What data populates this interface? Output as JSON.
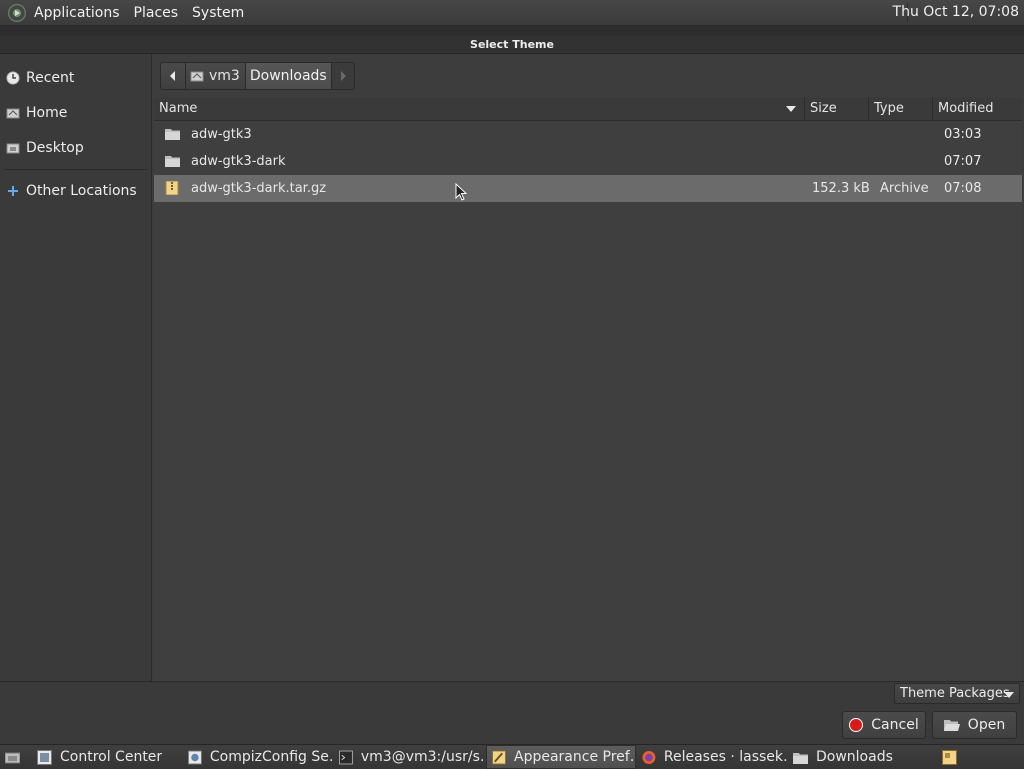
{
  "topbar": {
    "menus": [
      "Applications",
      "Places",
      "System"
    ],
    "clock": "Thu Oct 12, 07:08"
  },
  "dialog": {
    "title": "Select Theme"
  },
  "sidebar": {
    "items": [
      {
        "label": "Recent",
        "icon": "clock-icon"
      },
      {
        "label": "Home",
        "icon": "home-icon"
      },
      {
        "label": "Desktop",
        "icon": "desktop-icon"
      },
      {
        "label": "Other Locations",
        "icon": "plus-icon"
      }
    ]
  },
  "pathbar": {
    "segments": [
      "vm3",
      "Downloads"
    ]
  },
  "filelist": {
    "columns": {
      "name": "Name",
      "size": "Size",
      "type": "Type",
      "modified": "Modified"
    },
    "rows": [
      {
        "name": "adw-gtk3",
        "size": "",
        "type": "",
        "modified": "03:03",
        "icon": "folder-icon"
      },
      {
        "name": "adw-gtk3-dark",
        "size": "",
        "type": "",
        "modified": "07:07",
        "icon": "folder-icon"
      },
      {
        "name": "adw-gtk3-dark.tar.gz",
        "size": "152.3 kB",
        "type": "Archive",
        "modified": "07:08",
        "icon": "archive-icon",
        "selected": true
      }
    ]
  },
  "footer": {
    "filter_label": "Theme Packages",
    "cancel_label": "Cancel",
    "open_label": "Open"
  },
  "taskbar": {
    "tasks": [
      {
        "label": "Control Center",
        "icon": "control-center-icon"
      },
      {
        "label": "CompizConfig Se…",
        "icon": "compiz-icon"
      },
      {
        "label": "vm3@vm3:/usr/s…",
        "icon": "terminal-icon"
      },
      {
        "label": "Appearance Pref…",
        "icon": "appearance-icon",
        "active": true
      },
      {
        "label": "Releases · lassek…",
        "icon": "firefox-icon"
      },
      {
        "label": "Downloads",
        "icon": "folder-icon"
      }
    ]
  }
}
